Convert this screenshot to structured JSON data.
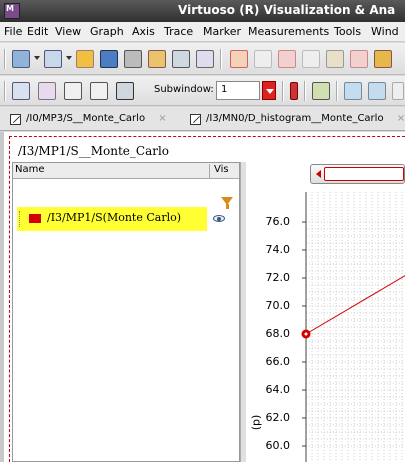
{
  "window": {
    "title": "Virtuoso (R) Visualization & Ana",
    "app_icon_text": "M"
  },
  "menu": {
    "items": [
      "File",
      "Edit",
      "View",
      "Graph",
      "Axis",
      "Trace",
      "Marker",
      "Measurements",
      "Tools",
      "Wind"
    ]
  },
  "toolbar": {
    "subwindow_label": "Subwindow:",
    "subwindow_value": "1"
  },
  "tabs": [
    {
      "label": "/I0/MP3/S__Monte_Carlo",
      "close": "×"
    },
    {
      "label": "/I3/MN0/D_histogram__Monte_Carlo",
      "close": "×"
    }
  ],
  "content": {
    "signal_path": "/I3/MP1/S__Monte_Carlo"
  },
  "panel": {
    "col_name": "Name",
    "col_vis": "Vis",
    "signal": {
      "label": "/I3/MP1/S(Monte Carlo)",
      "color": "#d40000",
      "highlight": "#ffff33"
    }
  },
  "chart_data": {
    "type": "line",
    "ylabel": "(p)",
    "yticks": [
      "76.0",
      "74.0",
      "72.0",
      "70.0",
      "68.0",
      "66.0",
      "64.0",
      "62.0",
      "60.0"
    ],
    "ylim": [
      59.5,
      77.0
    ],
    "series": [
      {
        "color": "#d40000",
        "points": [
          [
            0,
            68.0
          ],
          [
            1,
            72.5
          ]
        ]
      }
    ],
    "xlim": [
      0,
      1
    ],
    "grid": true
  },
  "colors": {
    "trace": "#d40000",
    "highlight": "#ffff33",
    "filter_icon": "#d88a1a"
  }
}
